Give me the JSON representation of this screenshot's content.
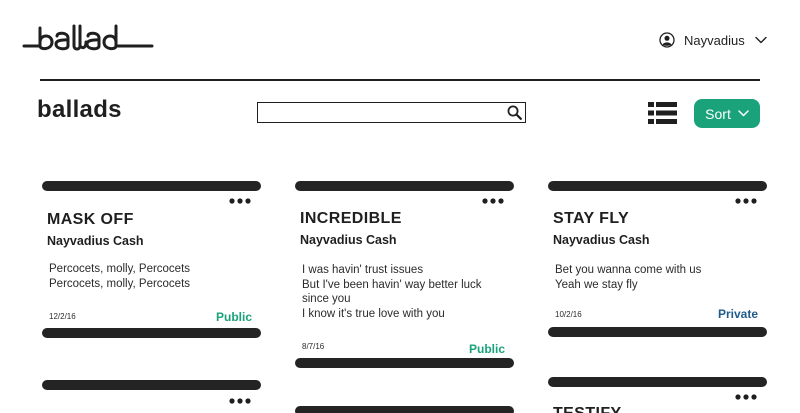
{
  "header": {
    "logo_text": "ballad",
    "user": {
      "name": "Nayvadius"
    }
  },
  "toolbar": {
    "page_title": "ballads",
    "search": {
      "value": "",
      "placeholder": ""
    },
    "sort_label": "Sort"
  },
  "colors": {
    "accent": "#1aa37a",
    "public": "#1aa37a",
    "private": "#1f5c8b",
    "text": "#1f1f1f"
  },
  "icons": {
    "user": "user-circle-icon",
    "dropdown": "chevron-down-icon",
    "search": "search-icon",
    "view": "list-view-icon",
    "card_menu": "more-dots-icon"
  },
  "ballads": [
    {
      "title": "MASK OFF",
      "artist": "Nayvadius Cash",
      "lyrics": [
        "Percocets, molly, Percocets",
        "Percocets, molly, Percocets"
      ],
      "date": "12/2/16",
      "visibility": "Public"
    },
    {
      "title": "INCREDIBLE",
      "artist": "Nayvadius Cash",
      "lyrics": [
        "I was havin' trust issues",
        "But I've been havin' way better luck",
        "since you",
        "I know it's true love with you"
      ],
      "date": "8/7/16",
      "visibility": "Public"
    },
    {
      "title": "STAY FLY",
      "artist": "Nayvadius Cash",
      "lyrics": [
        "Bet you wanna come with us",
        "Yeah we stay fly"
      ],
      "date": "10/2/16",
      "visibility": "Private"
    },
    {
      "title": "",
      "artist": "",
      "lyrics": [],
      "date": "",
      "visibility": ""
    },
    {
      "title": "",
      "artist": "",
      "lyrics": [],
      "date": "",
      "visibility": ""
    },
    {
      "title": "TESTIFY",
      "artist": "",
      "lyrics": [],
      "date": "",
      "visibility": ""
    }
  ]
}
